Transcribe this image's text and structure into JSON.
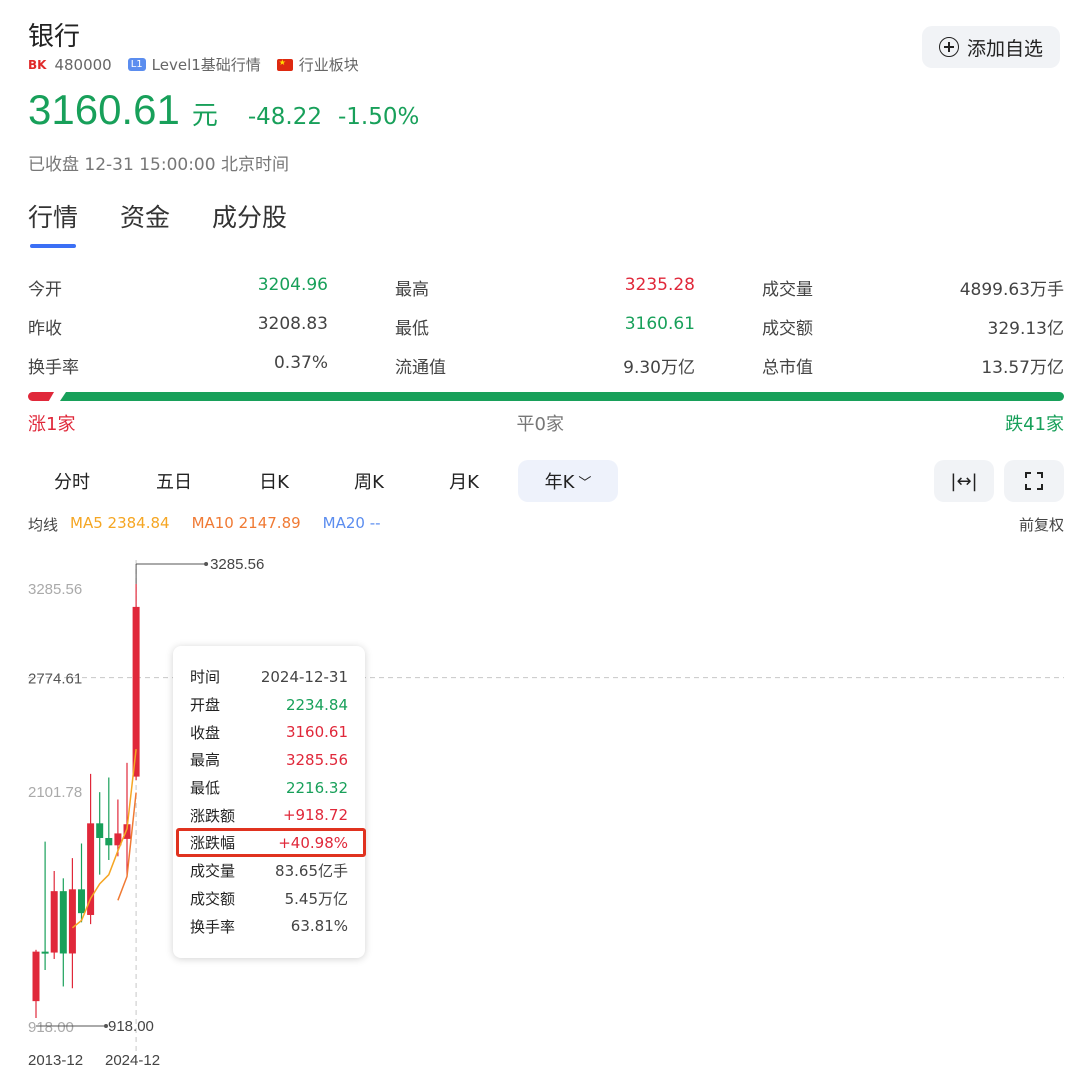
{
  "header": {
    "title": "银行",
    "market_badge": "BK",
    "code": "480000",
    "level_badge": "L1",
    "level_text": "Level1基础行情",
    "sector_text": "行业板块",
    "watch_button": "添加自选"
  },
  "quote": {
    "price": "3160.61",
    "unit": "元",
    "change": "-48.22",
    "change_pct": "-1.50%",
    "status": "已收盘 12-31 15:00:00 北京时间"
  },
  "tabs": [
    "行情",
    "资金",
    "成分股"
  ],
  "stats": [
    [
      {
        "label": "今开",
        "value": "3204.96",
        "color": "green"
      },
      {
        "label": "最高",
        "value": "3235.28",
        "color": "red"
      },
      {
        "label": "成交量",
        "value": "4899.63万手",
        "color": "neutral"
      }
    ],
    [
      {
        "label": "昨收",
        "value": "3208.83",
        "color": "neutral"
      },
      {
        "label": "最低",
        "value": "3160.61",
        "color": "green"
      },
      {
        "label": "成交额",
        "value": "329.13亿",
        "color": "neutral"
      }
    ],
    [
      {
        "label": "换手率",
        "value": "0.37%",
        "color": "neutral"
      },
      {
        "label": "流通值",
        "value": "9.30万亿",
        "color": "neutral"
      },
      {
        "label": "总市值",
        "value": "13.57万亿",
        "color": "neutral"
      }
    ]
  ],
  "breadth": {
    "up": "涨1家",
    "flat": "平0家",
    "down": "跌41家",
    "up_count": 1,
    "flat_count": 0,
    "down_count": 41
  },
  "period_tabs": [
    "分时",
    "五日",
    "日K",
    "周K",
    "月K",
    "年K"
  ],
  "active_period": "年K",
  "ma": {
    "label": "均线",
    "ma5": "MA5 2384.84",
    "ma10": "MA10 2147.89",
    "ma20": "MA20 --",
    "adjust": "前复权"
  },
  "colors": {
    "up": "#e0283a",
    "down": "#18a05a",
    "ma5": "#f5a623",
    "ma10": "#f07a34",
    "ma20": "#5b8def",
    "accent": "#3b6ff5"
  },
  "chart_data": {
    "type": "candlestick",
    "ylim": [
      918.0,
      3285.56
    ],
    "y_ticks": [
      "3285.56",
      "2774.61",
      "2101.78",
      "918.00"
    ],
    "x_labels": [
      "2013-12",
      "2024-12"
    ],
    "max_label": "3285.56",
    "min_label": "918.00",
    "candles": [
      {
        "open": 1010,
        "close": 1280,
        "high": 1290,
        "low": 918
      },
      {
        "open": 1280,
        "close": 1270,
        "high": 1880,
        "low": 1180
      },
      {
        "open": 1275,
        "close": 1610,
        "high": 1720,
        "low": 1240
      },
      {
        "open": 1610,
        "close": 1270,
        "high": 1680,
        "low": 1090
      },
      {
        "open": 1270,
        "close": 1620,
        "high": 1790,
        "low": 1080
      },
      {
        "open": 1620,
        "close": 1490,
        "high": 1870,
        "low": 1440
      },
      {
        "open": 1480,
        "close": 1980,
        "high": 2250,
        "low": 1430
      },
      {
        "open": 1980,
        "close": 1900,
        "high": 2150,
        "low": 1700
      },
      {
        "open": 1900,
        "close": 1860,
        "high": 2230,
        "low": 1780
      },
      {
        "open": 1860,
        "close": 1925,
        "high": 2110,
        "low": 1800
      },
      {
        "open": 1895,
        "close": 1975,
        "high": 2310,
        "low": 1700
      },
      {
        "open": 2234.84,
        "close": 3160.61,
        "high": 3285.56,
        "low": 2216.32
      }
    ],
    "ma5": [
      null,
      null,
      null,
      null,
      1410,
      1450,
      1570,
      1650,
      1700,
      1830,
      1950,
      2384.84
    ],
    "ma10": [
      null,
      null,
      null,
      null,
      null,
      null,
      null,
      null,
      null,
      1560,
      1690,
      2147.89
    ],
    "dashed_line_value": 2774.61,
    "red_dashed_value": 3160.61
  },
  "tooltip": {
    "rows": [
      {
        "label": "时间",
        "value": "2024-12-31",
        "color": "neutral"
      },
      {
        "label": "开盘",
        "value": "2234.84",
        "color": "green"
      },
      {
        "label": "收盘",
        "value": "3160.61",
        "color": "red"
      },
      {
        "label": "最高",
        "value": "3285.56",
        "color": "red"
      },
      {
        "label": "最低",
        "value": "2216.32",
        "color": "green"
      },
      {
        "label": "涨跌额",
        "value": "+918.72",
        "color": "red"
      },
      {
        "label": "涨跌幅",
        "value": "+40.98%",
        "color": "red"
      },
      {
        "label": "成交量",
        "value": "83.65亿手",
        "color": "neutral"
      },
      {
        "label": "成交额",
        "value": "5.45万亿",
        "color": "neutral"
      },
      {
        "label": "换手率",
        "value": "63.81%",
        "color": "neutral"
      }
    ]
  }
}
